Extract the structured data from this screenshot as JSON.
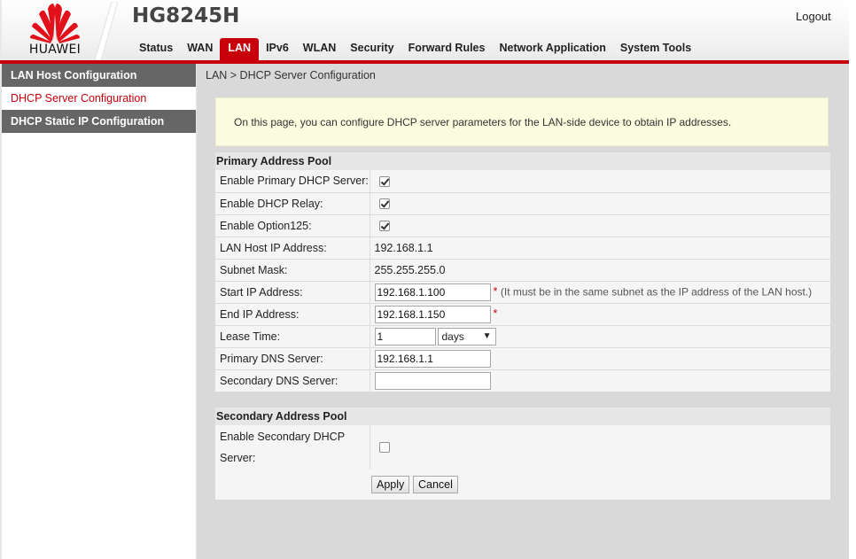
{
  "header": {
    "brand": "HUAWEI",
    "model": "HG8245H",
    "logout": "Logout",
    "nav": [
      "Status",
      "WAN",
      "LAN",
      "IPv6",
      "WLAN",
      "Security",
      "Forward Rules",
      "Network Application",
      "System Tools"
    ],
    "active_nav": "LAN"
  },
  "sidebar": {
    "items": [
      {
        "label": "LAN Host Configuration",
        "selected": false
      },
      {
        "label": "DHCP Server Configuration",
        "selected": true
      },
      {
        "label": "DHCP Static IP Configuration",
        "selected": false
      }
    ]
  },
  "main": {
    "breadcrumb": "LAN > DHCP Server Configuration",
    "info": "On this page, you can configure DHCP server parameters for the LAN-side device to obtain IP addresses.",
    "primary_pool": {
      "title": "Primary Address Pool",
      "enable_primary_label": "Enable Primary DHCP Server:",
      "enable_primary": true,
      "enable_relay_label": "Enable DHCP Relay:",
      "enable_relay": true,
      "enable_option125_label": "Enable Option125:",
      "enable_option125": true,
      "lan_host_ip_label": "LAN Host IP Address:",
      "lan_host_ip": "192.168.1.1",
      "subnet_mask_label": "Subnet Mask:",
      "subnet_mask": "255.255.255.0",
      "start_ip_label": "Start IP Address:",
      "start_ip": "192.168.1.100",
      "start_ip_hint": "(It must be in the same subnet as the IP address of the LAN host.)",
      "end_ip_label": "End IP Address:",
      "end_ip": "192.168.1.150",
      "required_mark": "*",
      "lease_time_label": "Lease Time:",
      "lease_time": "1",
      "lease_unit": "days",
      "primary_dns_label": "Primary DNS Server:",
      "primary_dns": "192.168.1.1",
      "secondary_dns_label": "Secondary DNS Server:",
      "secondary_dns": ""
    },
    "secondary_pool": {
      "title": "Secondary Address Pool",
      "enable_secondary_label_line1": "Enable Secondary DHCP",
      "enable_secondary_label_line2": "Server:",
      "enable_secondary": false
    },
    "buttons": {
      "apply": "Apply",
      "cancel": "Cancel"
    }
  },
  "colors": {
    "brand_red": "#c7000b",
    "sidebar_dark": "#666666",
    "info_bg": "#fbfbdf"
  }
}
